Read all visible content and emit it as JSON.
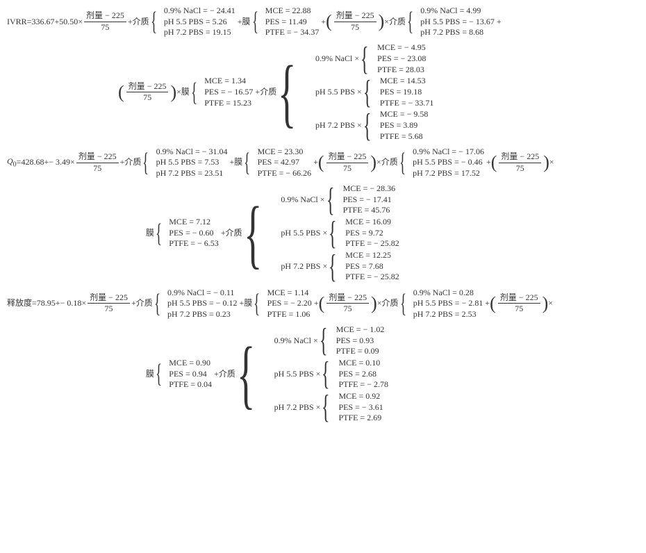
{
  "labels": {
    "ivrr": "IVRR",
    "q0": "Q",
    "q0sub": "0",
    "release": "释放度",
    "dose": "剂量",
    "medium": "介质",
    "membrane": "膜"
  },
  "eq1": {
    "c0": "336.67",
    "c1": "50.50",
    "dose_minus": "225",
    "dose_div": "75",
    "medium": {
      "a": "0.9% NaCl = − 24.41",
      "b": "pH 5.5 PBS = 5.26",
      "c": "pH 7.2 PBS = 19.15"
    },
    "memb": {
      "a": "MCE = 22.88",
      "b": "PES = 11.49",
      "c": "PTFE = − 34.37"
    },
    "dm": {
      "a": "0.9%  NaCl = 4.99",
      "b": "pH 5.5 PBS = − 13.67",
      "c": "pH 7.2 PBS = 8.68"
    },
    "dmemb": {
      "a": "MCE = 1.34",
      "b": "PES = − 16.57",
      "c": "PTFE = 15.23"
    },
    "cross": {
      "m1lab": "0.9% NaCl ×",
      "m1": {
        "a": "MCE = − 4.95",
        "b": "PES = − 23.08",
        "c": "PTFE = 28.03"
      },
      "m2lab": "pH 5.5 PBS ×",
      "m2": {
        "a": "MCE = 14.53",
        "b": "PES = 19.18",
        "c": "PTFE = − 33.71"
      },
      "m3lab": "pH 7.2 PBS ×",
      "m3": {
        "a": "MCE = − 9.58",
        "b": "PES = 3.89",
        "c": "PTFE = 5.68"
      }
    }
  },
  "eq2": {
    "c0": "428.68",
    "c1": "− 3.49",
    "dose_minus": "225",
    "dose_div": "75",
    "medium": {
      "a": "0.9% NaCl = − 31.04",
      "b": "pH 5.5 PBS = 7.53",
      "c": "pH 7.2 PBS = 23.51"
    },
    "memb": {
      "a": "MCE = 23.30",
      "b": "PES = 42.97",
      "c": "PTFE = − 66.26"
    },
    "dm": {
      "a": "0.9% NaCl = − 17.06",
      "b": "pH 5.5 PBS = − 0.46",
      "c": "pH 7.2 PBS = 17.52"
    },
    "dmemb": {
      "a": "MCE = 7.12",
      "b": "PES = − 0.60",
      "c": "PTFE = − 6.53"
    },
    "cross": {
      "m1lab": "0.9% NaCl ×",
      "m1": {
        "a": "MCE = − 28.36",
        "b": "PES = − 17.41",
        "c": "PTFE = 45.76"
      },
      "m2lab": "pH 5.5 PBS ×",
      "m2": {
        "a": "MCE = 16.09",
        "b": "PES = 9.72",
        "c": "PTFE = − 25.82"
      },
      "m3lab": "pH 7.2 PBS ×",
      "m3": {
        "a": "MCE = 12.25",
        "b": "PES = 7.68",
        "c": "PTFE = − 25.82"
      }
    }
  },
  "eq3": {
    "c0": "78.95",
    "c1": "− 0.18",
    "dose_minus": "225",
    "dose_div": "75",
    "medium": {
      "a": "0.9% NaCl = − 0.11",
      "b": "pH 5.5 PBS = − 0.12",
      "c": "pH 7.2 PBS = 0.23"
    },
    "memb": {
      "a": "MCE = 1.14",
      "b": "PES = − 2.20",
      "c": "PTFE = 1.06"
    },
    "dm": {
      "a": "0.9% NaCl = 0.28",
      "b": "pH 5.5 PBS = − 2.81",
      "c": "pH 7.2 PBS = 2.53"
    },
    "dmemb": {
      "a": "MCE = 0.90",
      "b": "PES = 0.94",
      "c": "PTFE = 0.04"
    },
    "cross": {
      "m1lab": "0.9% NaCl ×",
      "m1": {
        "a": "MCE = − 1.02",
        "b": "PES = 0.93",
        "c": "PTFE = 0.09"
      },
      "m2lab": "pH 5.5 PBS ×",
      "m2": {
        "a": "MCE = 0.10",
        "b": "PES = 2.68",
        "c": "PTFE = − 2.78"
      },
      "m3lab": "pH 7.2 PBS ×",
      "m3": {
        "a": "MCE = 0.92",
        "b": "PES = − 3.61",
        "c": "PTFE = 2.69"
      }
    }
  }
}
